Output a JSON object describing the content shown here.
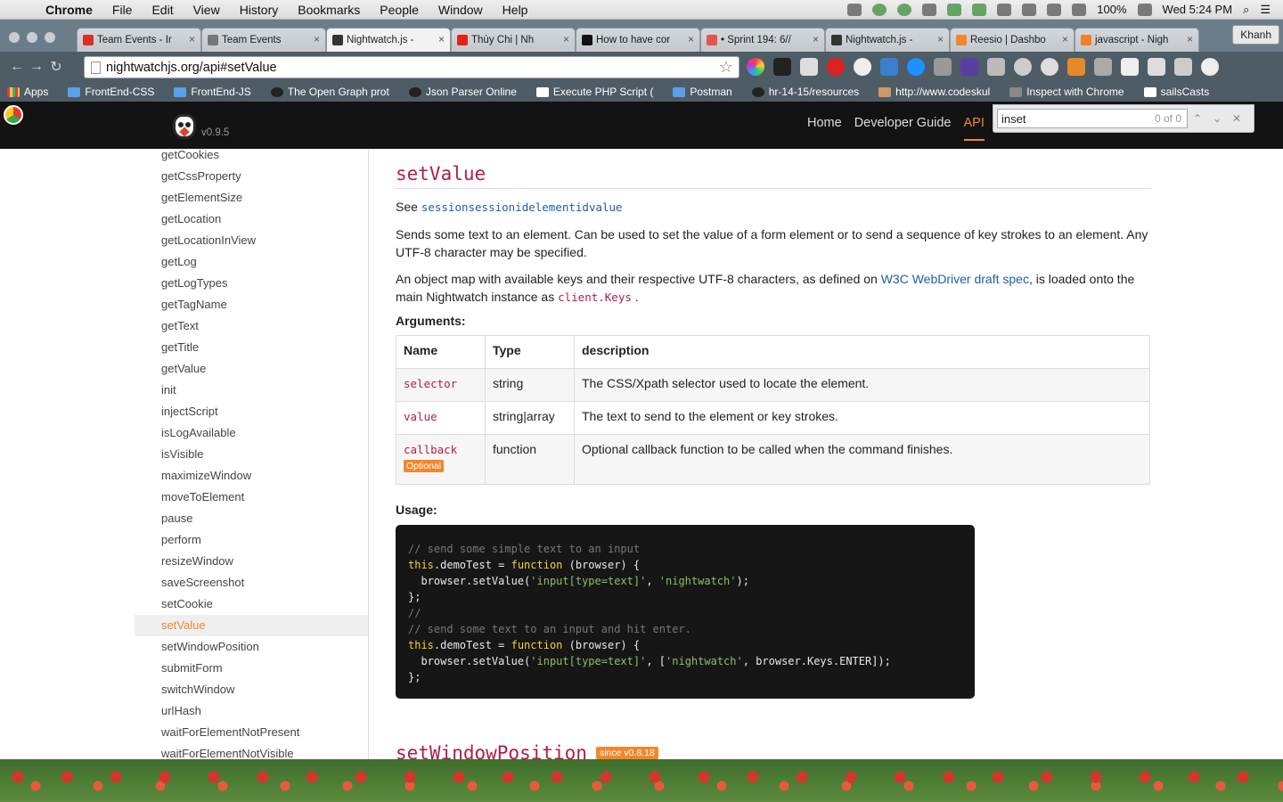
{
  "menubar": {
    "app": "Chrome",
    "items": [
      "File",
      "Edit",
      "View",
      "History",
      "Bookmarks",
      "People",
      "Window",
      "Help"
    ],
    "battery": "100%",
    "clock": "Wed 5:24 PM"
  },
  "tabs": [
    {
      "title": "Team Events - Ir",
      "color": "#d93025"
    },
    {
      "title": "Team Events",
      "color": "#777777"
    },
    {
      "title": "Nightwatch.js - ",
      "color": "#333333",
      "active": true
    },
    {
      "title": "Thùy Chi | Nh",
      "color": "#e62117"
    },
    {
      "title": "How to have cor",
      "color": "#111111"
    },
    {
      "title": "• Sprint 194: 6//",
      "color": "#e2574c"
    },
    {
      "title": "Nightwatch.js - ",
      "color": "#333333"
    },
    {
      "title": "Reesio | Dashbo",
      "color": "#f4862a"
    },
    {
      "title": "javascript - Nigh",
      "color": "#f48024"
    }
  ],
  "profile": "Khanh",
  "address_bar": {
    "url": "nightwatchjs.org/api#setValue"
  },
  "bookmarks": [
    {
      "label": "Apps",
      "icon": "apps-grid-icon"
    },
    {
      "label": "FrontEnd-CSS",
      "icon": "folder-icon"
    },
    {
      "label": "FrontEnd-JS",
      "icon": "folder-icon"
    },
    {
      "label": "The Open Graph prot",
      "icon": "opengraph-icon"
    },
    {
      "label": "Json Parser Online",
      "icon": "json-icon"
    },
    {
      "label": "Execute PHP Script (",
      "icon": "php-icon"
    },
    {
      "label": "Postman",
      "icon": "postman-icon"
    },
    {
      "label": "hr-14-15/resources",
      "icon": "github-icon"
    },
    {
      "label": "http://www.codeskul",
      "icon": "hammer-icon"
    },
    {
      "label": "Inspect with Chrome",
      "icon": "page-icon"
    },
    {
      "label": "sailsCasts",
      "icon": "sails-icon"
    }
  ],
  "site": {
    "version": "v0.9.5",
    "nav": [
      "Home",
      "Developer Guide",
      "API"
    ]
  },
  "find": {
    "query": "inset",
    "count": "0 of 0"
  },
  "sidebar": [
    "getCookies",
    "getCssProperty",
    "getElementSize",
    "getLocation",
    "getLocationInView",
    "getLog",
    "getLogTypes",
    "getTagName",
    "getText",
    "getTitle",
    "getValue",
    "init",
    "injectScript",
    "isLogAvailable",
    "isVisible",
    "maximizeWindow",
    "moveToElement",
    "pause",
    "perform",
    "resizeWindow",
    "saveScreenshot",
    "setCookie",
    "setValue",
    "setWindowPosition",
    "submitForm",
    "switchWindow",
    "urlHash",
    "waitForElementNotPresent",
    "waitForElementNotVisible"
  ],
  "sidebar_active": "setValue",
  "doc": {
    "title": "setValue",
    "see_label": "See",
    "see_link": "sessionsessionidelementidvalue",
    "desc1": "Sends some text to an element. Can be used to set the value of a form element or to send a sequence of key strokes to an element. Any UTF-8 character may be specified.",
    "desc2_before": "An object map with available keys and their respective UTF-8 characters, as defined on",
    "desc2_link": "W3C WebDriver draft spec",
    "desc2_after": ", is loaded onto the main Nightwatch instance as",
    "desc2_code": "client.Keys",
    "desc2_end": ".",
    "arguments_label": "Arguments:",
    "table_headers": [
      "Name",
      "Type",
      "description"
    ],
    "args": [
      {
        "name": "selector",
        "type": "string",
        "desc": "The CSS/Xpath selector used to locate the element."
      },
      {
        "name": "value",
        "type": "string|array",
        "desc": "The text to send to the element or key strokes."
      },
      {
        "name": "callback",
        "type": "function",
        "desc": "Optional callback function to be called when the command finishes.",
        "badge": "Optional"
      }
    ],
    "usage_label": "Usage:",
    "code": {
      "l1": "// send some simple text to an input",
      "l2a": "this",
      "l2b": ".demoTest = ",
      "l2c": "function",
      "l2d": " (browser) {",
      "l3a": "  browser.setValue(",
      "l3b": "'input[type=text]'",
      "l3c": ", ",
      "l3d": "'nightwatch'",
      "l3e": ");",
      "l4": "};",
      "l5": "//",
      "l6": "// send some text to an input and hit enter.",
      "l7a": "this",
      "l7b": ".demoTest = ",
      "l7c": "function",
      "l7d": " (browser) {",
      "l8a": "  browser.setValue(",
      "l8b": "'input[type=text]'",
      "l8c": ", [",
      "l8d": "'nightwatch'",
      "l8e": ", browser.Keys.ENTER]);",
      "l9": "};"
    },
    "next_title": "setWindowPosition",
    "next_since": "since v0.8.18"
  }
}
